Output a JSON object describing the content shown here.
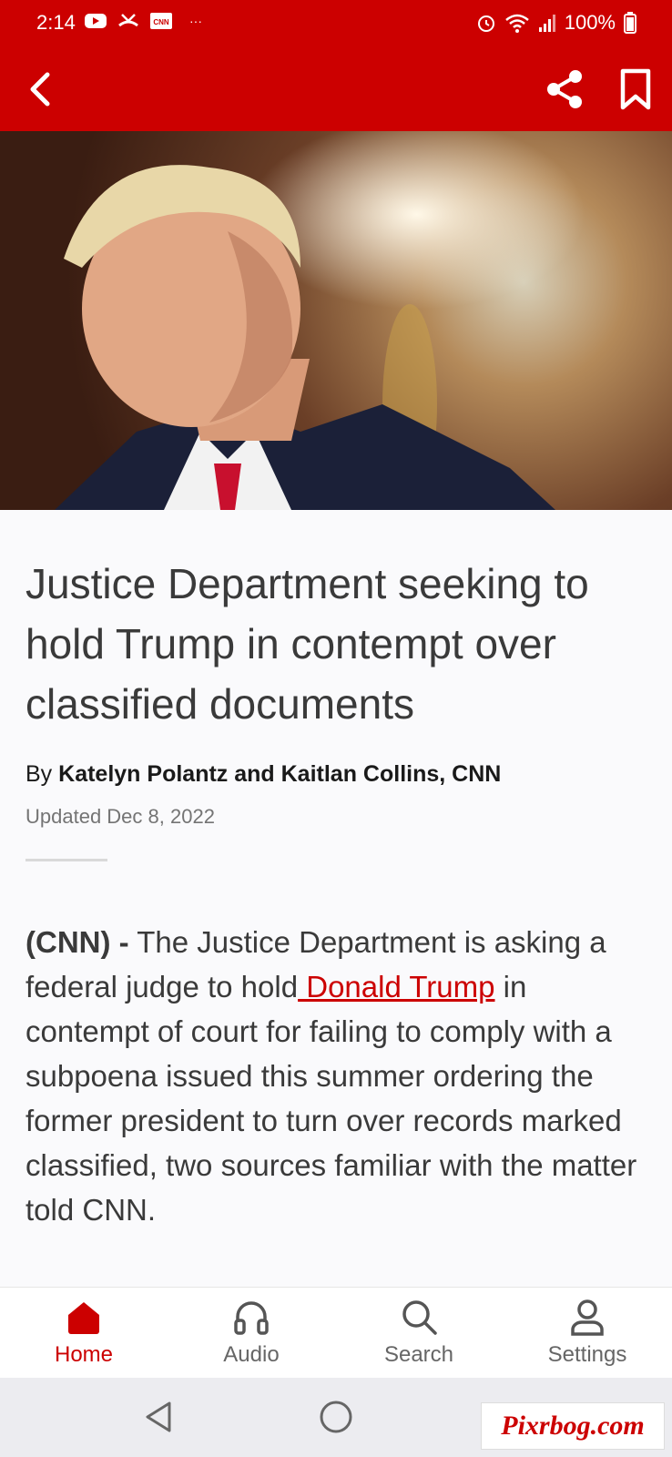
{
  "status_bar": {
    "time": "2:14",
    "battery": "100%",
    "left_icons": [
      "youtube-icon",
      "missed-call-icon",
      "cnn-icon",
      "more-dots-icon"
    ],
    "more": "···",
    "right_icons": [
      "alarm-icon",
      "wifi-icon",
      "signal-icon",
      "battery-icon"
    ]
  },
  "app_bar": {
    "background": "#cc0000",
    "back_icon": "chevron-left-icon",
    "share_icon": "share-icon",
    "bookmark_icon": "bookmark-icon"
  },
  "article": {
    "headline": "Justice Department seeking to hold Trump in contempt over classified documents",
    "byline_prefix": "By",
    "authors": "Katelyn Polantz and Kaitlan Collins, CNN",
    "updated": "Updated Dec 8, 2022",
    "body_lead": "(CNN) -",
    "body_part1": " The Justice Department is asking a federal judge to hold",
    "body_link": " Donald Trump",
    "body_part2": " in contempt of court for failing to comply with a subpoena issued this summer ordering the former president to turn over records marked classified, two sources familiar with the matter told CNN."
  },
  "bottom_nav": {
    "items": [
      {
        "label": "Home",
        "icon": "home-icon",
        "active": true
      },
      {
        "label": "Audio",
        "icon": "headphones-icon",
        "active": false
      },
      {
        "label": "Search",
        "icon": "search-icon",
        "active": false
      },
      {
        "label": "Settings",
        "icon": "person-icon",
        "active": false
      }
    ],
    "active_color": "#cc0000"
  },
  "system_nav": {
    "icons": [
      "back-triangle-icon",
      "home-circle-icon"
    ]
  },
  "watermark": "Pixrbog.com"
}
